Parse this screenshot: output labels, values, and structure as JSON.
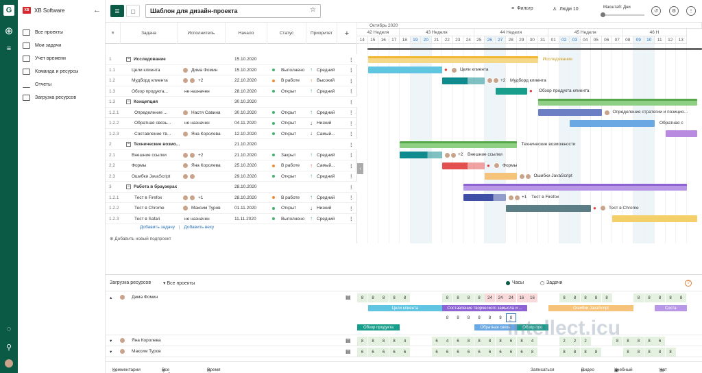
{
  "app": {
    "brand": "XB Software",
    "logo": "G",
    "brand_mark": "XB"
  },
  "nav": [
    {
      "label": "Все проекты",
      "icon": "folder-icon"
    },
    {
      "label": "Мои задачи",
      "icon": "folder-icon"
    },
    {
      "label": "Учет времени",
      "icon": "folder-icon"
    },
    {
      "label": "Команда и ресурсы",
      "icon": "team-icon"
    },
    {
      "label": "Отчеты",
      "icon": "chart-icon"
    },
    {
      "label": "Загрузка ресурсов",
      "icon": "grid-icon"
    }
  ],
  "toolbar": {
    "project_title": "Шаблон для дизайн-проекта",
    "filter": "Фильтр",
    "people": "Люди 10",
    "scale_label": "Масштаб: Дни"
  },
  "grid": {
    "headers": {
      "task": "Задача",
      "assignee": "Исполнитель",
      "start": "Начало",
      "status": "Статус",
      "priority": "Приоритет"
    },
    "rows": [
      {
        "id": "1",
        "name": "Исследование",
        "group": true,
        "assignee": "",
        "start": "15.10.2020",
        "status": "",
        "priority": ""
      },
      {
        "id": "1.1",
        "name": "Цели клиента",
        "assignee": "Дима Фомин",
        "avatars": 1,
        "start": "15.10.2020",
        "status": "Выполнено",
        "status_color": "#3db36b",
        "priority": "Средний",
        "prio_arrow": "↑",
        "prio_color": "#3db36b"
      },
      {
        "id": "1.2",
        "name": "Мудборд клиента",
        "assignee": "+2",
        "avatars": 2,
        "start": "22.10.2020",
        "status": "В работе",
        "status_color": "#f08c2e",
        "priority": "Высокий",
        "prio_arrow": "↑",
        "prio_color": "#f08c2e"
      },
      {
        "id": "1.3",
        "name": "Обзор продукта...",
        "assignee": "не назначен",
        "avatars": 0,
        "start": "28.10.2020",
        "status": "Открыт",
        "status_color": "#3db36b",
        "priority": "Средний",
        "prio_arrow": "↑",
        "prio_color": "#3db36b"
      },
      {
        "id": "1.3",
        "name": "Концепция",
        "group": true,
        "assignee": "",
        "start": "30.10.2020",
        "status": "",
        "priority": ""
      },
      {
        "id": "1.2.1",
        "name": "Определение ...",
        "assignee": "Настя Савина",
        "avatars": 1,
        "start": "30.10.2020",
        "status": "Открыт",
        "status_color": "#3db36b",
        "priority": "Средний",
        "prio_arrow": "↑",
        "prio_color": "#3db36b"
      },
      {
        "id": "1.2.2",
        "name": "Обратная связь...",
        "assignee": "не назначен",
        "avatars": 0,
        "start": "04.11.2020",
        "status": "Открыт",
        "status_color": "#3db36b",
        "priority": "Низкий",
        "prio_arrow": "↓",
        "prio_color": "#555555"
      },
      {
        "id": "1.2.3",
        "name": "Составление тв...",
        "assignee": "Яна Королева",
        "avatars": 1,
        "start": "12.10.2020",
        "status": "Открыт",
        "status_color": "#3db36b",
        "priority": "Самый...",
        "prio_arrow": "↓",
        "prio_color": "#555555"
      },
      {
        "id": "2",
        "name": "Технические возмо...",
        "group": true,
        "assignee": "",
        "start": "21.10.2020",
        "status": "",
        "priority": ""
      },
      {
        "id": "2.1",
        "name": "Внешние ссылки",
        "assignee": "+2",
        "avatars": 2,
        "start": "21.10.2020",
        "status": "Закрыт",
        "status_color": "#3db36b",
        "priority": "Средний",
        "prio_arrow": "↑",
        "prio_color": "#3db36b"
      },
      {
        "id": "2.2",
        "name": "Формы",
        "assignee": "Яна Королева",
        "avatars": 1,
        "start": "25.10.2020",
        "status": "В работе",
        "status_color": "#f08c2e",
        "priority": "Самый...",
        "prio_arrow": "↑",
        "prio_color": "#e04b4b"
      },
      {
        "id": "2.3",
        "name": "Ошибки JavaScript",
        "assignee": "",
        "avatars": 2,
        "start": "29.10.2020",
        "status": "Открыт",
        "status_color": "#3db36b",
        "priority": "Средний",
        "prio_arrow": "↑",
        "prio_color": "#3db36b"
      },
      {
        "id": "3",
        "name": "Работа в браузерах",
        "group": true,
        "assignee": "",
        "start": "28.10.2020",
        "status": "",
        "priority": ""
      },
      {
        "id": "1.2.1",
        "name": "Тест в Firefox",
        "assignee": "+1",
        "avatars": 2,
        "start": "28.10.2020",
        "status": "В работе",
        "status_color": "#f08c2e",
        "priority": "Средний",
        "prio_arrow": "↑",
        "prio_color": "#3db36b"
      },
      {
        "id": "1.2.2",
        "name": "Тест в Chrome",
        "assignee": "Максим Туров",
        "avatars": 1,
        "start": "01.11.2020",
        "status": "Открыт",
        "status_color": "#3db36b",
        "priority": "Низкий",
        "prio_arrow": "↓",
        "prio_color": "#555555"
      },
      {
        "id": "1.2.3",
        "name": "Тест в Safari",
        "assignee": "не назначен",
        "avatars": 0,
        "start": "11.11.2020",
        "status": "Выполнено",
        "status_color": "#3db36b",
        "priority": "Средний",
        "prio_arrow": "↑",
        "prio_color": "#3db36b"
      }
    ],
    "add_task": "Добавить задачу",
    "add_milestone": "Добавить веху",
    "add_project": "Добавить новый подпроект"
  },
  "timeline": {
    "month": "Октябрь 2020",
    "weeks": [
      "42 Неделя",
      "43 Неделя",
      "44 Неделя",
      "45 Неделя",
      "46 Н"
    ],
    "days": [
      "14",
      "15",
      "16",
      "17",
      "18",
      "19",
      "20",
      "21",
      "22",
      "23",
      "24",
      "25",
      "26",
      "27",
      "28",
      "29",
      "30",
      "31",
      "01",
      "02",
      "03",
      "04",
      "05",
      "06",
      "07",
      "08",
      "09",
      "10",
      "11",
      "12",
      "13"
    ],
    "weekend_days": [
      "19",
      "20",
      "26",
      "27",
      "02",
      "03",
      "09",
      "10"
    ],
    "bar_labels": {
      "research": "Исследование",
      "client_goals": "Цели клиента",
      "moodboard": "Мудборд клиента",
      "review": "Обзор продукта клиента",
      "strategy": "Определение стратегии и позицио...",
      "feedback": "Обратная с",
      "tech": "Технические возможности",
      "links": "Внешние ссылки",
      "forms": "Формы",
      "js": "Ошибки JavaScript",
      "firefox": "Тест в Firefox",
      "chrome": "Тест в Chrome"
    },
    "plus2": "+2",
    "plus1": "+1"
  },
  "resources": {
    "title": "Загрузка ресурсов",
    "filter": "Все проекты",
    "radio_hours": "Часы",
    "radio_tasks": "Задачи",
    "people": [
      {
        "name": "Дима Фомин",
        "counts": [
          "8",
          "8",
          "8",
          "8",
          "8",
          "",
          "",
          "",
          "8",
          "8",
          "8",
          "8",
          "24",
          "24",
          "24",
          "16",
          "16",
          "",
          "",
          "8",
          "8",
          "8",
          "8",
          "8",
          "",
          "",
          "8",
          "8",
          "8",
          "8",
          "8"
        ]
      },
      {
        "name": "Яна Королева",
        "counts": [
          "8",
          "8",
          "8",
          "8",
          "4",
          "",
          "",
          "6",
          "4",
          "6",
          "8",
          "8",
          "8",
          "8",
          "6",
          "8",
          "4",
          "",
          "",
          "2",
          "2",
          "2",
          "",
          "",
          "8",
          "8",
          "8",
          "8",
          "6",
          "",
          ""
        ]
      },
      {
        "name": "Максим Туров",
        "counts": [
          "6",
          "6",
          "6",
          "6",
          "6",
          "",
          "",
          "6",
          "6",
          "6",
          "6",
          "6",
          "6",
          "6",
          "6",
          "6",
          "8",
          "",
          "",
          "8",
          "8",
          "8",
          "8",
          "",
          "",
          "8",
          "8",
          "8",
          "8",
          "8",
          ""
        ]
      }
    ],
    "bars": {
      "goals": "Цели клиента",
      "tz": "Составление творческого замысла и ...",
      "js": "Ошибки JavaScript",
      "review": "Обзор продукта",
      "feedback": "Обратная связь",
      "review2": "Обзор про",
      "cut": "Соста"
    },
    "sub_counts": [
      "8",
      "8",
      "8",
      "8",
      "8",
      "8",
      "8"
    ]
  },
  "footer": {
    "comments": "Комментарии",
    "files": "Все файлы",
    "time": "Время на задачи",
    "demo": "Записаться на демо",
    "video": "Видео",
    "learn": "Учебный центр",
    "support": "Чат поддержки"
  },
  "watermark": "intellect.icu"
}
